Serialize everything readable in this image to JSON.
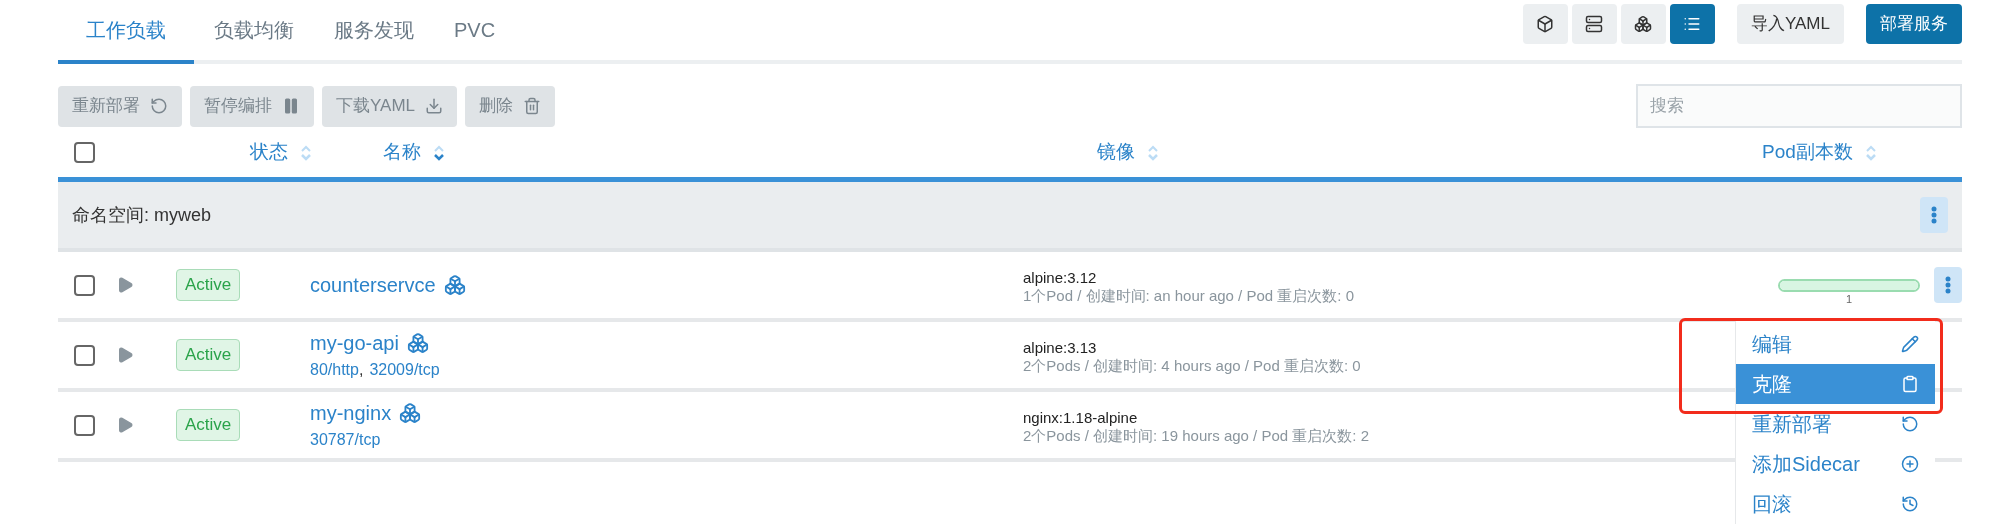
{
  "tabs": [
    {
      "label": "工作负载",
      "selected": true
    },
    {
      "label": "负载均衡",
      "selected": false
    },
    {
      "label": "服务发现",
      "selected": false
    },
    {
      "label": "PVC",
      "selected": false
    }
  ],
  "view_buttons": [
    {
      "kind": "cube",
      "selected": false
    },
    {
      "kind": "servers",
      "selected": false
    },
    {
      "kind": "cubes",
      "selected": false
    },
    {
      "kind": "list",
      "selected": true
    }
  ],
  "import_button": "导入YAML",
  "deploy_button": "部署服务",
  "bulk_actions": [
    {
      "label": "重新部署",
      "kind": "redeploy"
    },
    {
      "label": "暂停编排",
      "kind": "pause"
    },
    {
      "label": "下载YAML",
      "kind": "download"
    },
    {
      "label": "删除",
      "kind": "delete"
    }
  ],
  "search": {
    "placeholder": "搜索"
  },
  "select_all": {
    "checked": false
  },
  "columns": [
    {
      "label": "状态",
      "sorted": false
    },
    {
      "label": "名称",
      "sorted": true
    },
    {
      "label": "镜像",
      "sorted": false
    },
    {
      "label": "Pod副本数",
      "sorted": false
    }
  ],
  "namespace": {
    "label": "命名空间: myweb"
  },
  "port_separator": ",",
  "rows": [
    {
      "checked": false,
      "status": "Active",
      "name": "counterservce",
      "ports": [],
      "image": "alpine:3.12",
      "details": "1个Pod / 创建时间: an hour ago / Pod 重启次数: 0",
      "scale": {
        "level": 1,
        "label": "1"
      }
    },
    {
      "checked": false,
      "status": "Active",
      "name": "my-go-api",
      "ports": [
        "80/http",
        "32009/tcp"
      ],
      "image": "alpine:3.13",
      "details": "2个Pods / 创建时间: 4 hours ago / Pod 重启次数: 0"
    },
    {
      "checked": false,
      "status": "Active",
      "name": "my-nginx",
      "ports": [
        "30787/tcp"
      ],
      "image": "nginx:1.18-alpine",
      "details": "2个Pods / 创建时间: 19 hours ago / Pod 重启次数: 2"
    }
  ],
  "menu": [
    {
      "label": "编辑",
      "kind": "edit",
      "selected": false
    },
    {
      "label": "克隆",
      "kind": "clone",
      "selected": true
    },
    {
      "label": "重新部署",
      "kind": "redeploy",
      "selected": false
    },
    {
      "label": "添加Sidecar",
      "kind": "sidecar",
      "selected": false
    },
    {
      "label": "回滚",
      "kind": "rollback",
      "selected": false
    }
  ]
}
